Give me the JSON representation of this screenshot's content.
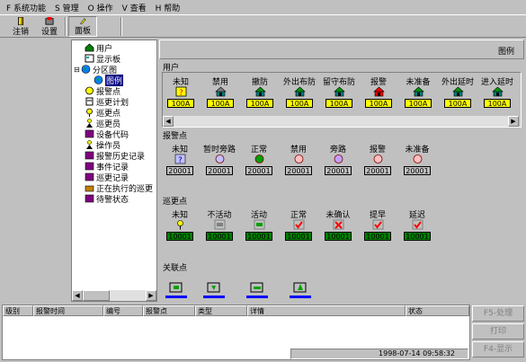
{
  "menu": [
    "F 系统功能",
    "S 管理",
    "O 操作",
    "V 查看",
    "H 帮助"
  ],
  "toolbar": {
    "logout": "注销",
    "settings": "设置",
    "panel": "面板"
  },
  "tree": [
    "用户",
    "显示板",
    "分区图",
    "图例",
    "报警点",
    "巡更计划",
    "巡更点",
    "巡更员",
    "设备代码",
    "操作员",
    "报警历史记录",
    "事件记录",
    "巡更记录",
    "正在执行的巡更",
    "待警状态"
  ],
  "header_title": "图例",
  "user": {
    "title": "用户",
    "items": [
      {
        "label": "未知",
        "code": "100A",
        "color": "#ffff00"
      },
      {
        "label": "禁用",
        "code": "100A",
        "color": "#ffff00"
      },
      {
        "label": "撤防",
        "code": "100A",
        "color": "#ffff00"
      },
      {
        "label": "外出布防",
        "code": "100A",
        "color": "#ffff00"
      },
      {
        "label": "留守布防",
        "code": "100A",
        "color": "#ffff00"
      },
      {
        "label": "报警",
        "code": "100A",
        "color": "#ffff00"
      },
      {
        "label": "未准备",
        "code": "100A",
        "color": "#ffff00"
      },
      {
        "label": "外出延时",
        "code": "100A",
        "color": "#ffff00"
      },
      {
        "label": "进入延时",
        "code": "100A",
        "color": "#ffff00"
      }
    ]
  },
  "alarm": {
    "title": "报警点",
    "items": [
      {
        "label": "未知",
        "code": "20001"
      },
      {
        "label": "暂时旁路",
        "code": "20001"
      },
      {
        "label": "正常",
        "code": "20001"
      },
      {
        "label": "禁用",
        "code": "20001"
      },
      {
        "label": "旁路",
        "code": "20001"
      },
      {
        "label": "报警",
        "code": "20001"
      },
      {
        "label": "未准备",
        "code": "20001"
      }
    ]
  },
  "patrol": {
    "title": "巡更点",
    "items": [
      {
        "label": "未知",
        "code": "10001"
      },
      {
        "label": "不活动",
        "code": "10001"
      },
      {
        "label": "活动",
        "code": "10001"
      },
      {
        "label": "正常",
        "code": "10001"
      },
      {
        "label": "未确认",
        "code": "10001"
      },
      {
        "label": "提早",
        "code": "10001"
      },
      {
        "label": "延迟",
        "code": "10001"
      }
    ]
  },
  "link": {
    "title": "关联点"
  },
  "table": {
    "columns": [
      "级别",
      "报警时间",
      "编号",
      "报警点",
      "类型",
      "详情",
      "状态"
    ]
  },
  "side_buttons": [
    "F5-处理",
    "打印",
    "F4-显示"
  ],
  "status_time": "1998-07-14  09:58:32",
  "colors": {
    "user_badge": "#ffff00",
    "patrol_badge": "#008000",
    "selection": "#000080"
  }
}
